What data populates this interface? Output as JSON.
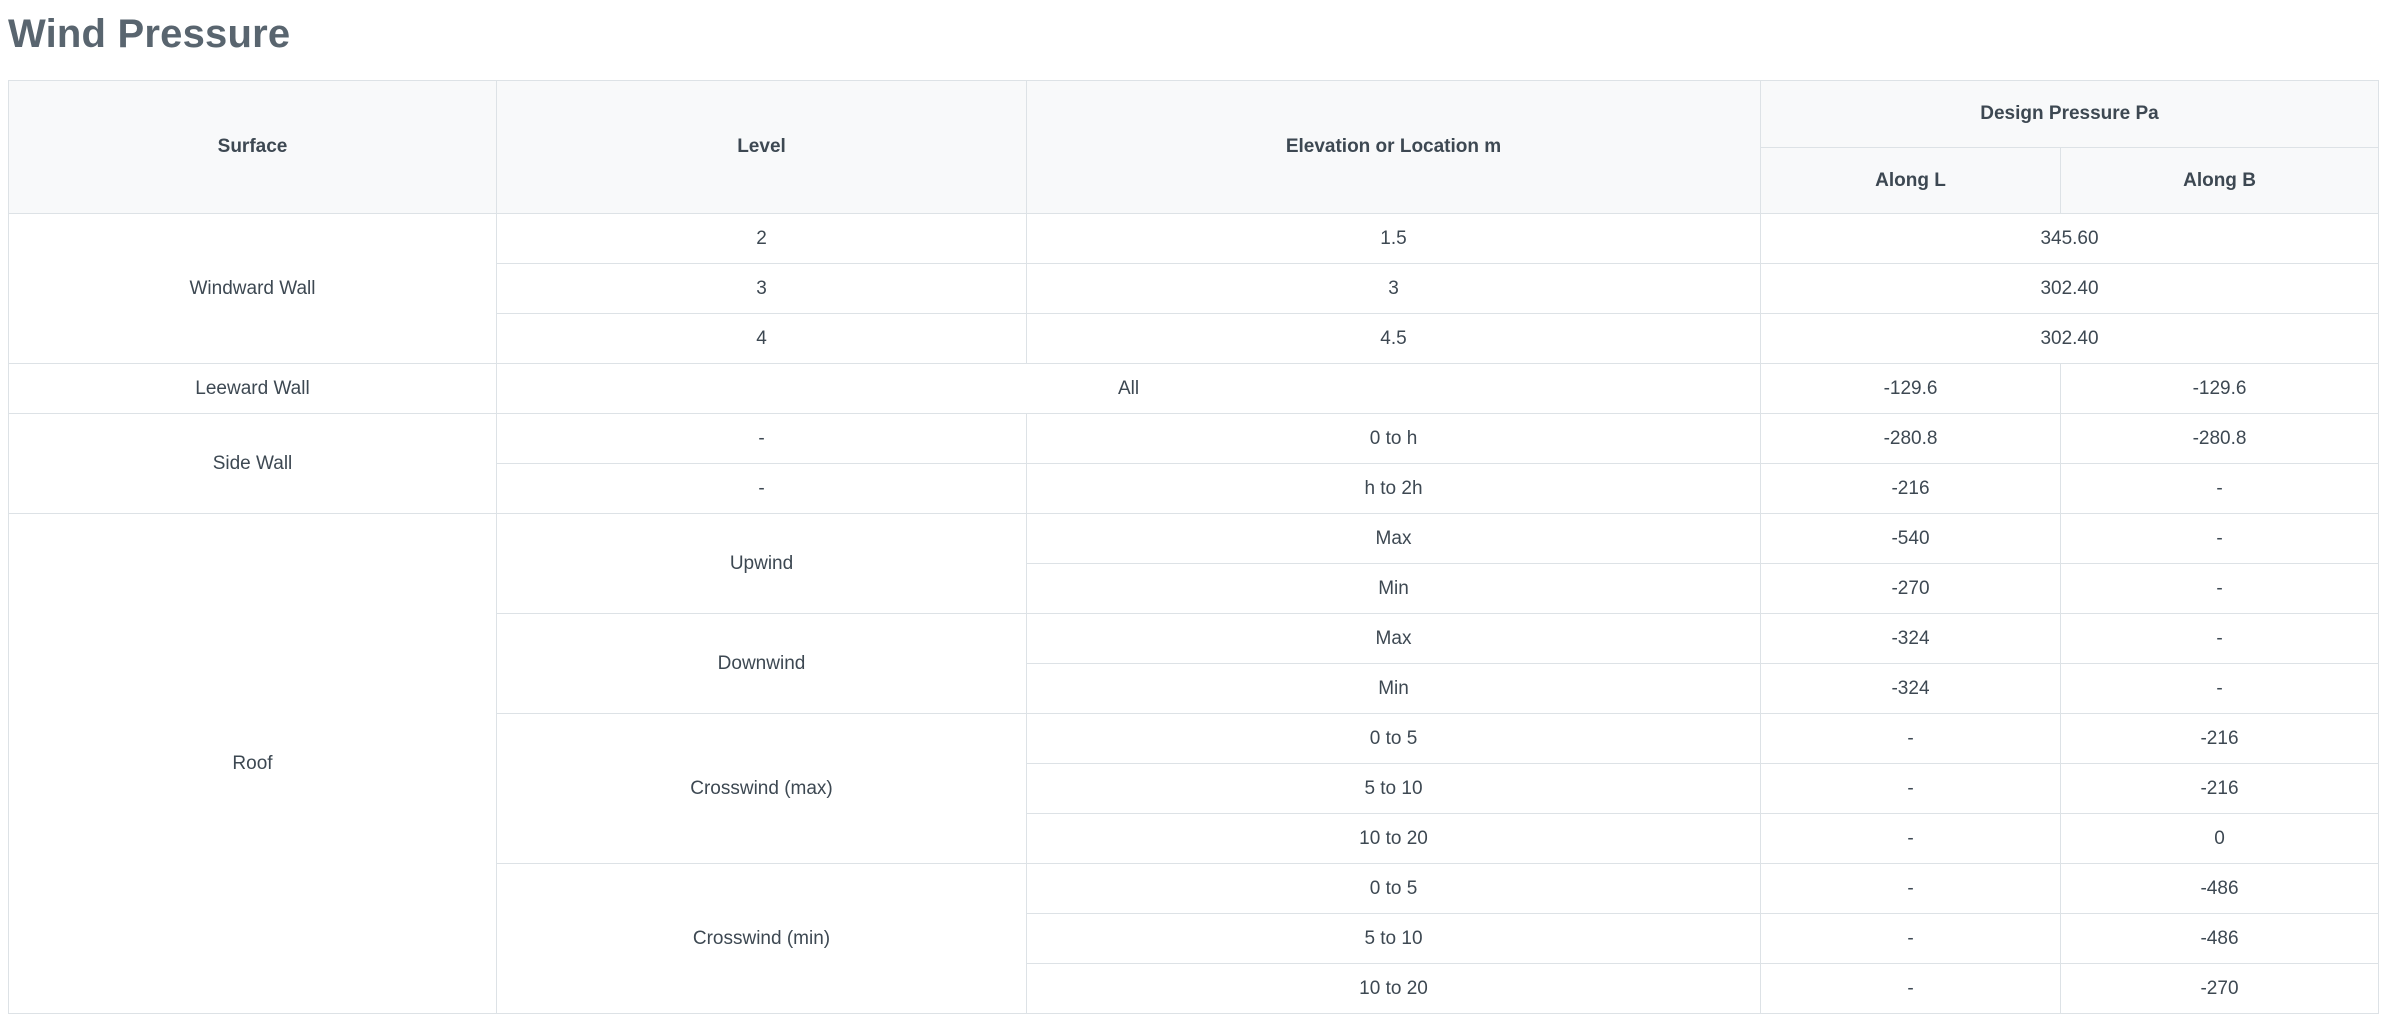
{
  "page": {
    "title": "Wind Pressure"
  },
  "table": {
    "headers": {
      "surface": "Surface",
      "level": "Level",
      "elevation": "Elevation or Location m",
      "design_pressure": "Design Pressure Pa",
      "along_l": "Along L",
      "along_b": "Along B"
    },
    "windward": {
      "surface": "Windward Wall",
      "rows": [
        {
          "level": "2",
          "elevation": "1.5",
          "pressure": "345.60"
        },
        {
          "level": "3",
          "elevation": "3",
          "pressure": "302.40"
        },
        {
          "level": "4",
          "elevation": "4.5",
          "pressure": "302.40"
        }
      ]
    },
    "leeward": {
      "surface": "Leeward Wall",
      "level_elevation": "All",
      "along_l": "-129.6",
      "along_b": "-129.6"
    },
    "side": {
      "surface": "Side Wall",
      "rows": [
        {
          "level": "-",
          "elevation": "0 to h",
          "along_l": "-280.8",
          "along_b": "-280.8"
        },
        {
          "level": "-",
          "elevation": "h to 2h",
          "along_l": "-216",
          "along_b": "-"
        }
      ]
    },
    "roof": {
      "surface": "Roof",
      "upwind": {
        "level": "Upwind",
        "rows": [
          {
            "elevation": "Max",
            "along_l": "-540",
            "along_b": "-"
          },
          {
            "elevation": "Min",
            "along_l": "-270",
            "along_b": "-"
          }
        ]
      },
      "downwind": {
        "level": "Downwind",
        "rows": [
          {
            "elevation": "Max",
            "along_l": "-324",
            "along_b": "-"
          },
          {
            "elevation": "Min",
            "along_l": "-324",
            "along_b": "-"
          }
        ]
      },
      "crosswind_max": {
        "level": "Crosswind (max)",
        "rows": [
          {
            "elevation": "0 to 5",
            "along_l": "-",
            "along_b": "-216"
          },
          {
            "elevation": "5 to 10",
            "along_l": "-",
            "along_b": "-216"
          },
          {
            "elevation": "10 to 20",
            "along_l": "-",
            "along_b": "0"
          }
        ]
      },
      "crosswind_min": {
        "level": "Crosswind (min)",
        "rows": [
          {
            "elevation": "0 to 5",
            "along_l": "-",
            "along_b": "-486"
          },
          {
            "elevation": "5 to 10",
            "along_l": "-",
            "along_b": "-486"
          },
          {
            "elevation": "10 to 20",
            "along_l": "-",
            "along_b": "-270"
          }
        ]
      }
    }
  }
}
